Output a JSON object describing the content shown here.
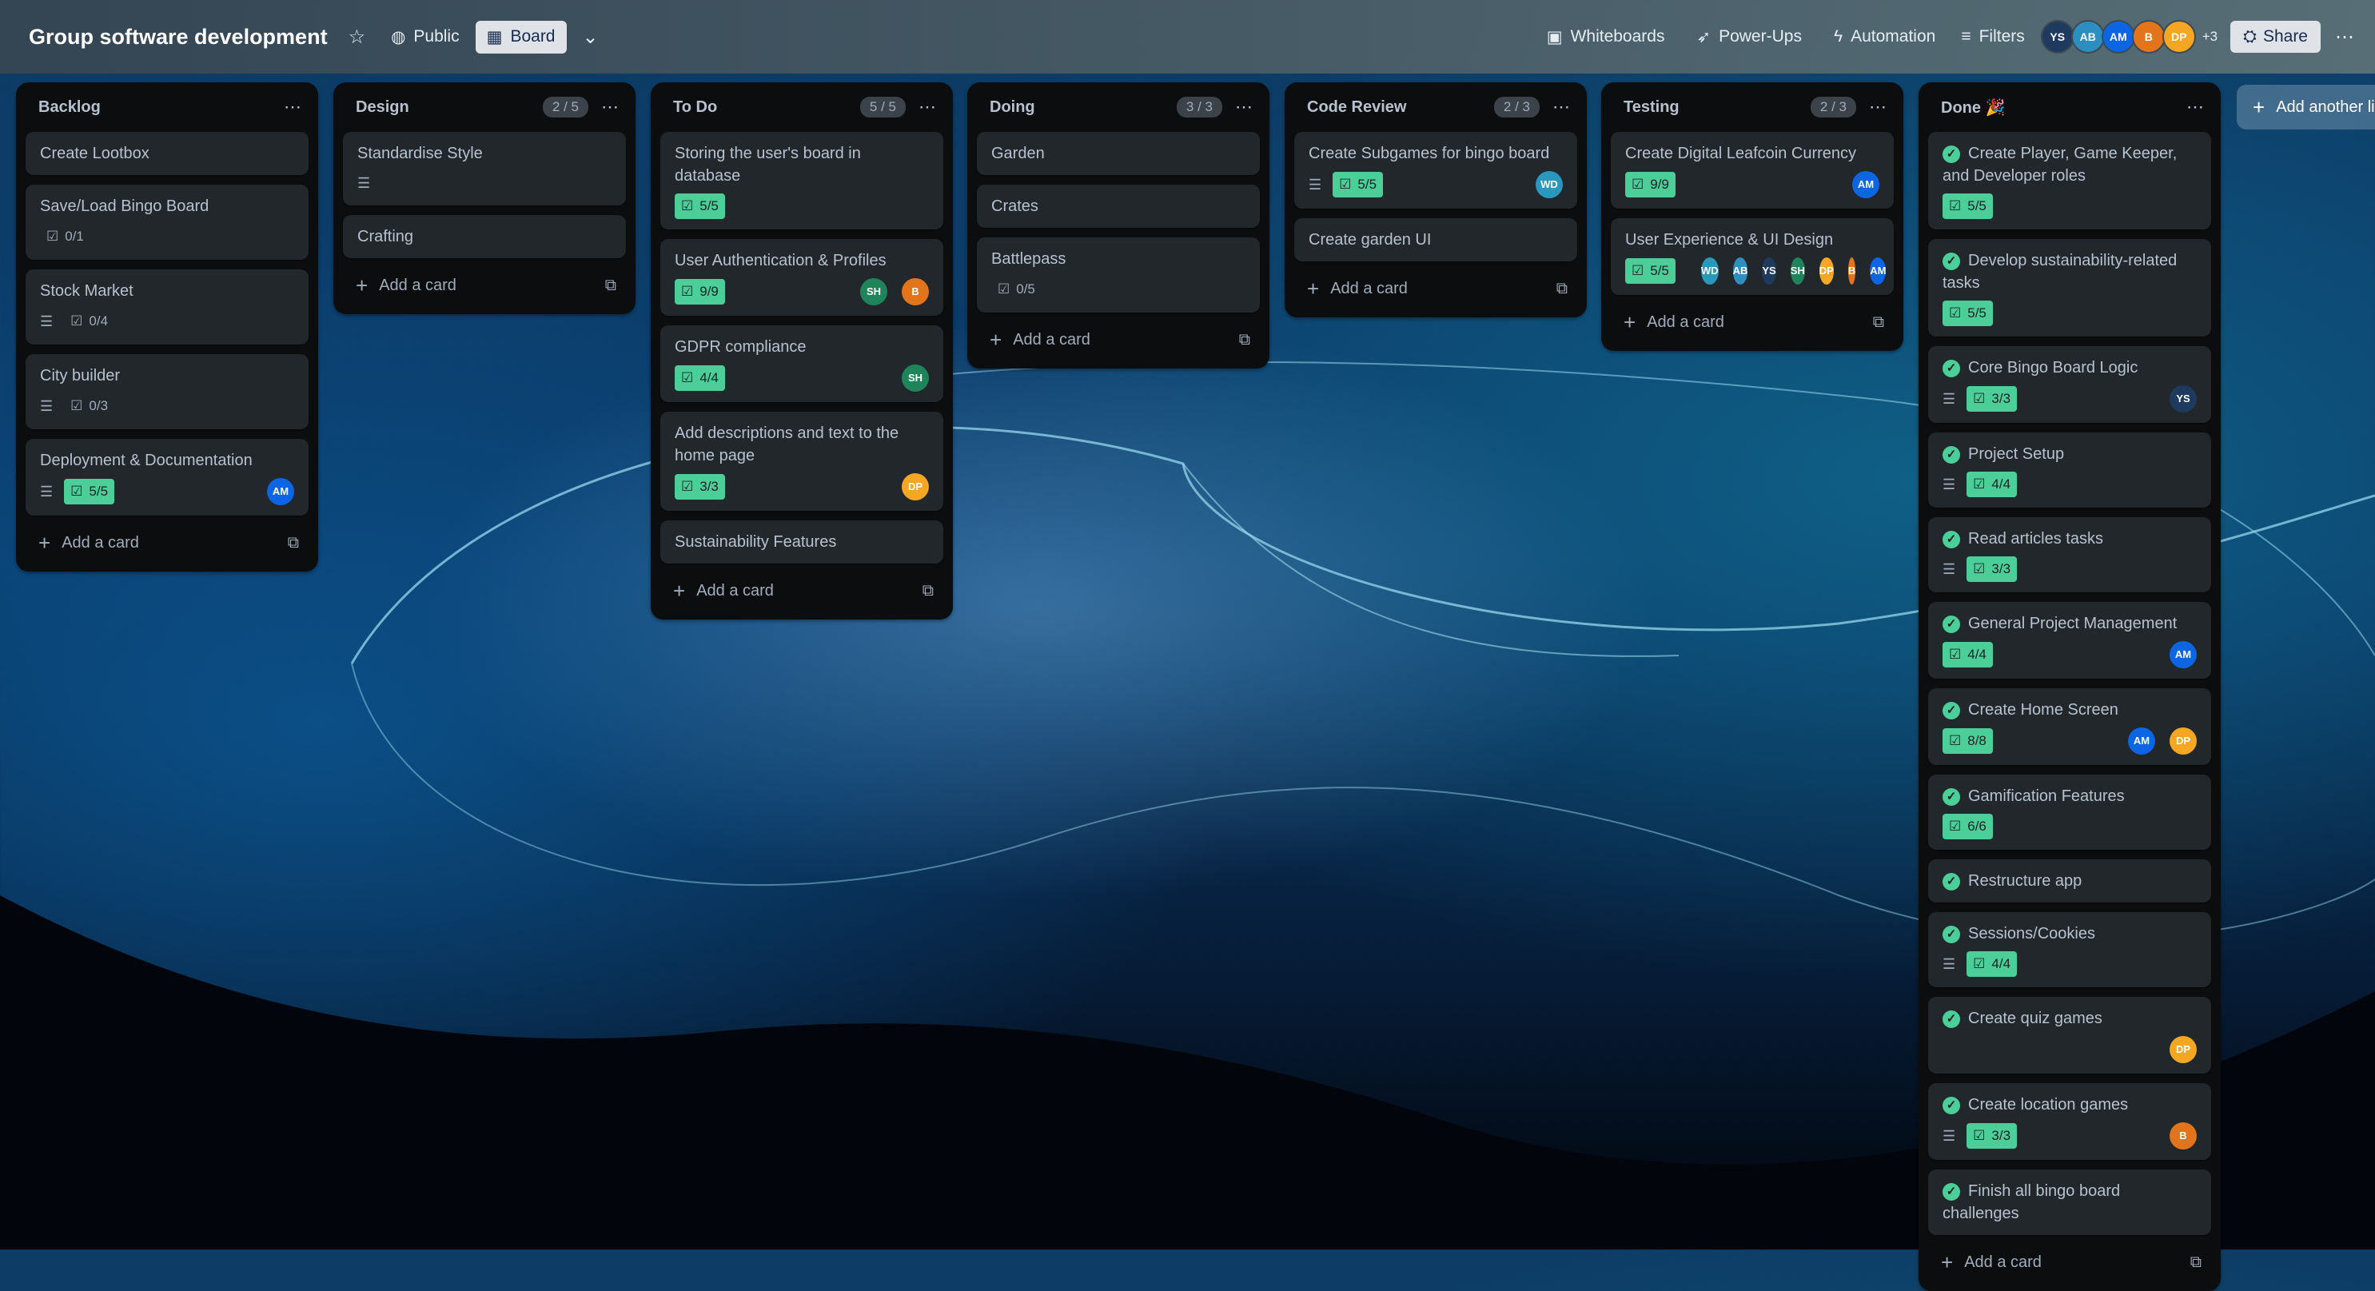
{
  "board": {
    "title": "Group software development",
    "visibility": "Public",
    "view": "Board"
  },
  "toolbar": {
    "whiteboards": "Whiteboards",
    "powerups": "Power-Ups",
    "automation": "Automation",
    "filters": "Filters",
    "share": "Share",
    "extra_members": "+3",
    "members": [
      {
        "initials": "YS",
        "color": "#1f3a5f"
      },
      {
        "initials": "AB",
        "color": "#2d8fbf"
      },
      {
        "initials": "AM",
        "color": "#0c66e4"
      },
      {
        "initials": "B",
        "color": "#e2751b"
      },
      {
        "initials": "DP",
        "color": "#f5a623"
      }
    ]
  },
  "add_card_label": "Add a card",
  "add_list_label": "Add another list",
  "lists": [
    {
      "title": "Backlog",
      "count": "",
      "cards": [
        {
          "title": "Create Lootbox"
        },
        {
          "title": "Save/Load Bingo Board",
          "check": "0/1"
        },
        {
          "title": "Stock Market",
          "desc": true,
          "check": "0/4"
        },
        {
          "title": "City builder",
          "desc": true,
          "check": "0/3"
        },
        {
          "title": "Deployment & Documentation",
          "desc": true,
          "check": "5/5",
          "check_done": true,
          "members": [
            {
              "initials": "AM",
              "color": "#0c66e4"
            }
          ]
        }
      ]
    },
    {
      "title": "Design",
      "count": "2 / 5",
      "cards": [
        {
          "title": "Standardise Style",
          "desc": true
        },
        {
          "title": "Crafting"
        }
      ]
    },
    {
      "title": "To Do",
      "count": "5 / 5",
      "cards": [
        {
          "title": "Storing the user's board in database",
          "check": "5/5",
          "check_done": true
        },
        {
          "title": "User Authentication & Profiles",
          "check": "9/9",
          "check_done": true,
          "members": [
            {
              "initials": "SH",
              "color": "#1f845a"
            },
            {
              "initials": "B",
              "color": "#e2751b"
            }
          ]
        },
        {
          "title": "GDPR compliance",
          "check": "4/4",
          "check_done": true,
          "members": [
            {
              "initials": "SH",
              "color": "#1f845a"
            }
          ]
        },
        {
          "title": "Add descriptions and text to the home page",
          "check": "3/3",
          "check_done": true,
          "members": [
            {
              "initials": "DP",
              "color": "#f5a623"
            }
          ]
        },
        {
          "title": "Sustainability Features"
        }
      ]
    },
    {
      "title": "Doing",
      "count": "3 / 3",
      "cards": [
        {
          "title": "Garden"
        },
        {
          "title": "Crates"
        },
        {
          "title": "Battlepass",
          "check": "0/5"
        }
      ]
    },
    {
      "title": "Code Review",
      "count": "2 / 3",
      "cards": [
        {
          "title": "Create Subgames for bingo board",
          "desc": true,
          "check": "5/5",
          "check_done": true,
          "members": [
            {
              "initials": "WD",
              "color": "#2898bd"
            }
          ]
        },
        {
          "title": "Create garden UI"
        }
      ]
    },
    {
      "title": "Testing",
      "count": "2 / 3",
      "cards": [
        {
          "title": "Create Digital Leafcoin Currency",
          "check": "9/9",
          "check_done": true,
          "members": [
            {
              "initials": "AM",
              "color": "#0c66e4"
            }
          ]
        },
        {
          "title": "User Experience & UI Design",
          "check": "5/5",
          "check_done": true,
          "members": [
            {
              "initials": "WD",
              "color": "#2898bd"
            },
            {
              "initials": "AB",
              "color": "#2d8fbf"
            },
            {
              "initials": "YS",
              "color": "#1f3a5f"
            },
            {
              "initials": "SH",
              "color": "#1f845a"
            },
            {
              "initials": "DP",
              "color": "#f5a623"
            },
            {
              "initials": "B",
              "color": "#e2751b"
            },
            {
              "initials": "AM",
              "color": "#0c66e4"
            }
          ]
        }
      ]
    },
    {
      "title": "Done 🎉",
      "count": "",
      "cards": [
        {
          "title": "Create Player, Game Keeper, and Developer roles",
          "complete": true,
          "check": "5/5",
          "check_done": true
        },
        {
          "title": "Develop sustainability-related tasks",
          "complete": true,
          "check": "5/5",
          "check_done": true
        },
        {
          "title": "Core Bingo Board Logic",
          "complete": true,
          "desc": true,
          "check": "3/3",
          "check_done": true,
          "members": [
            {
              "initials": "YS",
              "color": "#1f3a5f"
            }
          ]
        },
        {
          "title": "Project Setup",
          "complete": true,
          "desc": true,
          "check": "4/4",
          "check_done": true
        },
        {
          "title": "Read articles tasks",
          "complete": true,
          "desc": true,
          "check": "3/3",
          "check_done": true
        },
        {
          "title": "General Project Management",
          "complete": true,
          "check": "4/4",
          "check_done": true,
          "members": [
            {
              "initials": "AM",
              "color": "#0c66e4"
            }
          ]
        },
        {
          "title": "Create Home Screen",
          "complete": true,
          "check": "8/8",
          "check_done": true,
          "members": [
            {
              "initials": "AM",
              "color": "#0c66e4"
            },
            {
              "initials": "DP",
              "color": "#f5a623"
            }
          ]
        },
        {
          "title": "Gamification Features",
          "complete": true,
          "check": "6/6",
          "check_done": true
        },
        {
          "title": "Restructure app",
          "complete": true
        },
        {
          "title": "Sessions/Cookies",
          "complete": true,
          "desc": true,
          "check": "4/4",
          "check_done": true
        },
        {
          "title": "Create quiz games",
          "complete": true,
          "members": [
            {
              "initials": "DP",
              "color": "#f5a623"
            }
          ]
        },
        {
          "title": "Create location games",
          "complete": true,
          "desc": true,
          "check": "3/3",
          "check_done": true,
          "members": [
            {
              "initials": "B",
              "color": "#e2751b"
            }
          ]
        },
        {
          "title": "Finish all bingo board challenges",
          "complete": true
        }
      ]
    }
  ]
}
